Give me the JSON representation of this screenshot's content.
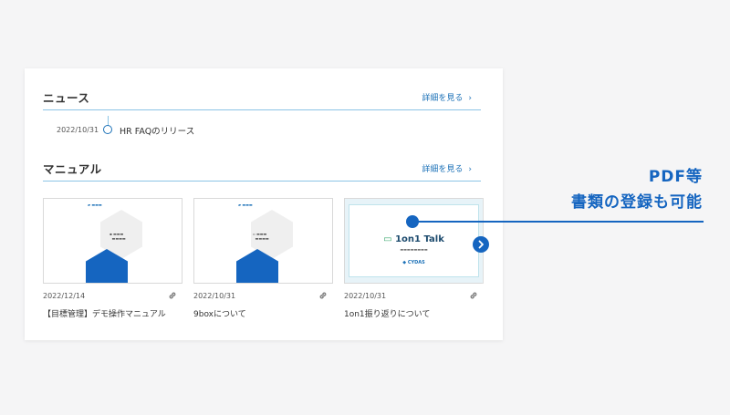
{
  "news": {
    "title": "ニュース",
    "detail_label": "詳細を見る",
    "items": [
      {
        "date": "2022/10/31",
        "text": "HR FAQのリリース"
      }
    ]
  },
  "manual": {
    "title": "マニュアル",
    "detail_label": "詳細を見る",
    "docs": [
      {
        "date": "2022/12/14",
        "title": "【目標管理】デモ操作マニュアル"
      },
      {
        "date": "2022/10/31",
        "title": "9boxについて"
      },
      {
        "date": "2022/10/31",
        "title": "1on1振り返りについて"
      }
    ],
    "thumb3": {
      "title": "1on1 Talk",
      "brand": "CYDAS"
    }
  },
  "callout": {
    "line1": "PDF等",
    "line2": "書類の登録も可能"
  },
  "colors": {
    "accent": "#1565c0",
    "link": "#1d72b8",
    "divider": "#8cc4e6",
    "background": "#f5f5f6"
  }
}
